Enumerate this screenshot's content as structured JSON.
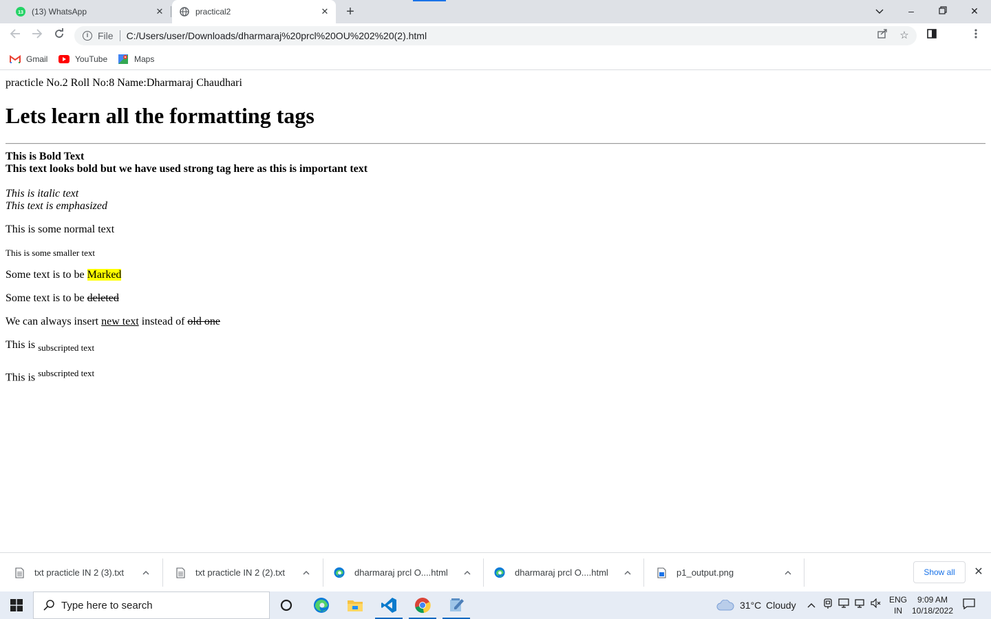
{
  "browser": {
    "tabs": [
      {
        "title": "(13) WhatsApp",
        "badge": "13",
        "active": false
      },
      {
        "title": "practical2",
        "active": true
      }
    ],
    "new_tab": "+",
    "window_controls": {
      "dropdown": "⌄",
      "minimize": "–",
      "restore": "❐",
      "close": "✕"
    },
    "address": {
      "scheme_label": "File",
      "url": "C:/Users/user/Downloads/dharmaraj%20prcl%20OU%202%20(2).html"
    },
    "bookmarks": [
      {
        "label": "Gmail",
        "icon": "gmail-icon"
      },
      {
        "label": "YouTube",
        "icon": "youtube-icon"
      },
      {
        "label": "Maps",
        "icon": "maps-icon"
      }
    ]
  },
  "page": {
    "intro": "practicle No.2 Roll No:8 Name:Dharmaraj Chaudhari",
    "heading": "Lets learn all the formatting tags",
    "bold_text": "This is Bold Text",
    "strong_text": "This text looks bold but we have used strong tag here as this is important text",
    "italic_text": "This is italic text",
    "em_text": "This text is emphasized",
    "normal_text": "This is some normal text",
    "small_text": "This is some smaller text",
    "mark_prefix": "Some text is to be ",
    "mark_text": "Marked",
    "del_prefix": "Some text is to be ",
    "del_text": "deleted",
    "ins_prefix": "We can always insert ",
    "ins_text": "new text",
    "ins_middle": " instead of ",
    "ins_old": "old one",
    "sub_prefix": "This is ",
    "sub_text": "subscripted text",
    "sup_prefix": "This is ",
    "sup_text": "subscripted text",
    "mark_color": "#ffff00"
  },
  "downloads": {
    "items": [
      {
        "name": "txt practicle IN 2 (3).txt",
        "icon": "text-file-icon"
      },
      {
        "name": "txt practicle IN 2 (2).txt",
        "icon": "text-file-icon"
      },
      {
        "name": "dharmaraj prcl O....html",
        "icon": "edge-icon"
      },
      {
        "name": "dharmaraj prcl O....html",
        "icon": "edge-icon"
      },
      {
        "name": "p1_output.png",
        "icon": "image-file-icon"
      }
    ],
    "show_all": "Show all"
  },
  "taskbar": {
    "search_placeholder": "Type here to search",
    "weather": {
      "temp": "31°C",
      "condition": "Cloudy"
    },
    "language": {
      "line1": "ENG",
      "line2": "IN"
    },
    "clock": {
      "time": "9:09 AM",
      "date": "10/18/2022"
    }
  }
}
